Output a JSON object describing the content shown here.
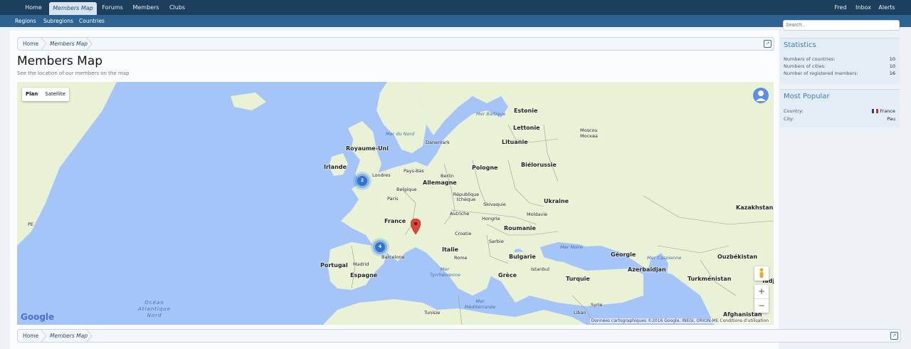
{
  "nav": {
    "tabs": [
      "Home",
      "Members Map",
      "Forums",
      "Members",
      "Clubs"
    ],
    "active": "Members Map",
    "user": "Fred",
    "inbox": "Inbox",
    "alerts": "Alerts"
  },
  "subnav": {
    "links": [
      "Regions",
      "Subregions",
      "Countries"
    ]
  },
  "breadcrumb": {
    "items": [
      "Home",
      "Members Map"
    ]
  },
  "page": {
    "title": "Members Map",
    "description": "See the location of our members on the map"
  },
  "map": {
    "toggle": [
      "Plan",
      "Satellite"
    ],
    "active_toggle": "Plan",
    "zoom_in": "+",
    "zoom_out": "−",
    "logo": "Google",
    "copyright": "Données cartographiques ©2016 Google, INEGI, ORION-ME   Conditions d'utilisation",
    "countries": [
      "Estonie",
      "Lettonie",
      "Lituanie",
      "Royaume-Uni",
      "Irlande",
      "Pays-Bas",
      "Danemark",
      "Pologne",
      "Biélorussie",
      "Allemagne",
      "Belgique",
      "République tchèque",
      "Slovaquie",
      "Autriche",
      "Hongrie",
      "Moldavie",
      "Ukraine",
      "France",
      "Croatie",
      "Roumanie",
      "Serbie",
      "Italie",
      "Bulgarie",
      "Portugal",
      "Espagne",
      "Grèce",
      "Turquie",
      "Géorgie",
      "Azerbaïdjan",
      "Turkménistan",
      "Ouzbékistan",
      "Kazakhstan",
      "Syrie",
      "Liban",
      "Tunisie",
      "Afghanistan",
      "Tadji"
    ],
    "cities": [
      "Londres",
      "Berlin",
      "Paris",
      "Moscou",
      "Москва",
      "Madrid",
      "Barcelone",
      "Rome",
      "Istanbul"
    ],
    "seas": [
      "Mer Baltique",
      "Mer du Nord",
      "Mer Noire",
      "Mer Caspienne",
      "Mer Tyrrhénienne",
      "Mer Méditerranée"
    ],
    "ocean": [
      "Océan",
      "Atlantique",
      "Nord"
    ],
    "fragments": [
      "PE"
    ],
    "clusters": [
      {
        "count": "2",
        "near": "Royaume-Uni"
      },
      {
        "count": "4",
        "near": "Espagne"
      }
    ],
    "marker": "France",
    "colors": {
      "water": "#a5c4f7",
      "land": "#eaf2d6",
      "cluster": "#2f73d4",
      "marker": "#e0453a"
    }
  },
  "sidebar": {
    "search_placeholder": "Search...",
    "statistics": {
      "title": "Statistics",
      "rows": [
        {
          "label": "Numbers of countries:",
          "value": "10"
        },
        {
          "label": "Numbers of cities:",
          "value": "10"
        },
        {
          "label": "Number of registered members:",
          "value": "16"
        }
      ]
    },
    "popular": {
      "title": "Most Popular",
      "rows": [
        {
          "label": "Country:",
          "value": "France"
        },
        {
          "label": "City:",
          "value": "Pau"
        }
      ]
    }
  }
}
